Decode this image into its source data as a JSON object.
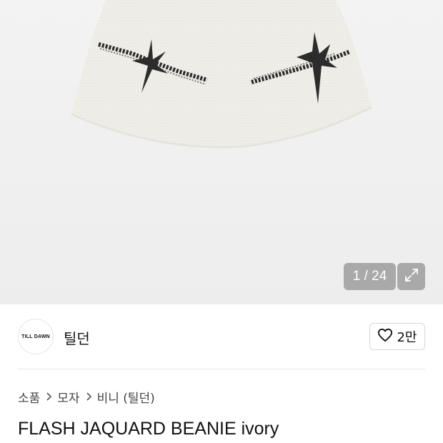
{
  "gallery": {
    "counter": "1 / 24",
    "image_alt": "FLASH JAQUARD BEANIE ivory"
  },
  "brand": {
    "logo_text": "TILL DAWN",
    "name": "틸던",
    "like_count": "2만"
  },
  "breadcrumb": {
    "items": [
      "소품",
      "모자",
      "비니 (틸던)"
    ]
  },
  "product": {
    "title": "FLASH JAQUARD BEANIE ivory"
  },
  "colors": {
    "hero_bg": "#efefef",
    "counter_bg": "#999999",
    "divider": "#e6e6e6"
  },
  "icons": {
    "expand": "expand-icon",
    "like": "heart-icon",
    "breadcrumb_separator": "chevron-right-icon"
  }
}
